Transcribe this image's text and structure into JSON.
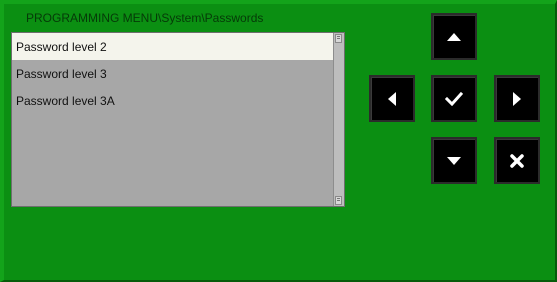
{
  "window": {
    "title": "PROGRAMMING MENU\\System\\Passwords"
  },
  "menu_list": {
    "items": [
      {
        "label": "Password level 2",
        "selected": true
      },
      {
        "label": "Password level 3",
        "selected": false
      },
      {
        "label": "Password level 3A",
        "selected": false
      }
    ]
  },
  "nav_buttons": {
    "up": "arrow-up-icon",
    "left": "arrow-left-icon",
    "ok": "checkmark-icon",
    "right": "arrow-right-icon",
    "down": "arrow-down-icon",
    "cancel": "cross-icon"
  },
  "colors": {
    "background": "#0b8f12",
    "list_background": "#a7a7a7",
    "selected_row": "#f4f4ec",
    "button": "#000000",
    "icon": "#ffffff"
  }
}
